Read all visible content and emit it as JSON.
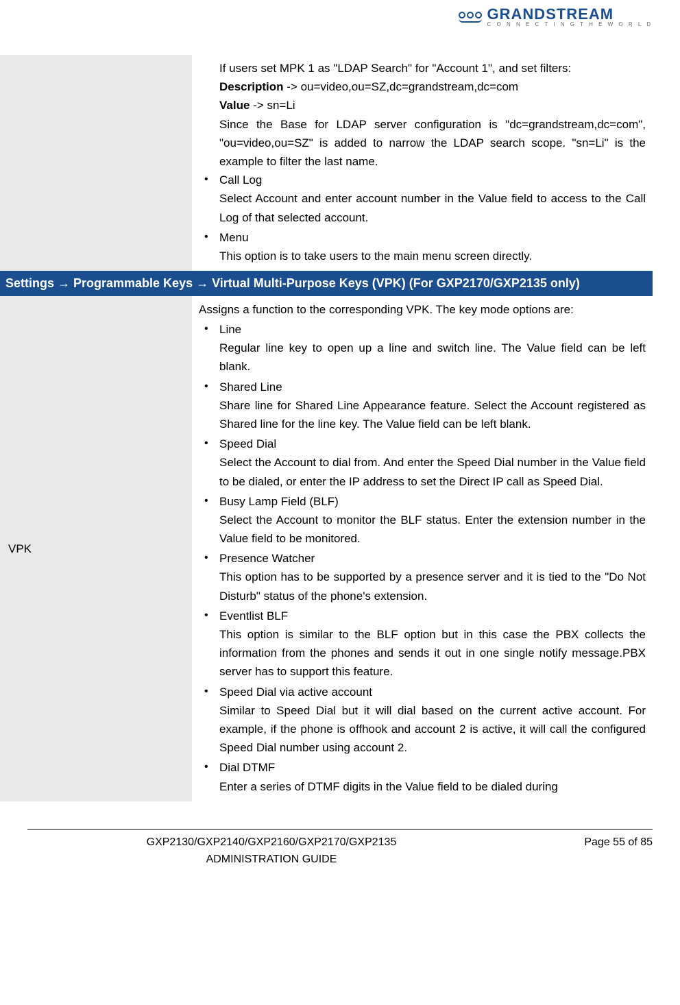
{
  "logo": {
    "main": "GRANDSTREAM",
    "sub": "C O N N E C T I N G   T H E   W O R L D"
  },
  "section1": {
    "pre": {
      "line1_a": "If users set MPK 1 as \"LDAP Search\" for \"Account 1\", and set filters:",
      "line2_label": "Description",
      "line2_val": " -> ou=video,ou=SZ,dc=grandstream,dc=com",
      "line3_label": "Value",
      "line3_val": " -> sn=Li",
      "line4": "Since the Base for LDAP server configuration is \"dc=grandstream,dc=com\", \"ou=video,ou=SZ\" is added to narrow the LDAP search scope. \"sn=Li\" is the example to filter the last name."
    },
    "items": [
      {
        "title": "Call Log",
        "desc": "Select Account and enter account number in the Value field to access to the Call Log of that selected account."
      },
      {
        "title": "Menu",
        "desc": "This option is to take users to the main menu screen directly."
      }
    ]
  },
  "header_row": "Settings → Programmable Keys → Virtual Multi-Purpose Keys (VPK) (For GXP2170/GXP2135 only)",
  "section2": {
    "left_label": "VPK",
    "intro": "Assigns a function to the corresponding VPK. The key mode options are:",
    "items": [
      {
        "title": "Line",
        "desc": "Regular line key to open up a line and switch line. The Value field can be left blank."
      },
      {
        "title": "Shared Line",
        "desc": "Share line for Shared Line Appearance feature. Select the Account registered as Shared line for the line key. The Value field can be left blank."
      },
      {
        "title": "Speed Dial",
        "desc": "Select the Account to dial from. And enter the Speed Dial number in the Value field to be dialed, or enter the IP address to set the Direct IP call as Speed Dial."
      },
      {
        "title": "Busy Lamp Field (BLF)",
        "desc": "Select the Account to monitor the BLF status. Enter the extension number in the Value field to be monitored."
      },
      {
        "title": "Presence Watcher",
        "desc": "This option has to be supported by a presence server and it is tied to the \"Do Not Disturb\" status of the phone's extension."
      },
      {
        "title": "Eventlist BLF",
        "desc": "This option is similar to the BLF option but in this case the PBX collects the information from the phones and sends it out in one single notify message.PBX server has to support this feature."
      },
      {
        "title": "Speed Dial via active account",
        "desc": "Similar to Speed Dial but it will dial based on the current active account. For example, if the phone is offhook and account 2 is active, it will call the configured Speed Dial number using account 2."
      },
      {
        "title": "Dial DTMF",
        "desc": "Enter a series of DTMF digits in the Value field to be dialed during"
      }
    ]
  },
  "footer": {
    "title_line1": "GXP2130/GXP2140/GXP2160/GXP2170/GXP2135",
    "title_line2": "ADMINISTRATION GUIDE",
    "page": "Page 55 of 85"
  }
}
